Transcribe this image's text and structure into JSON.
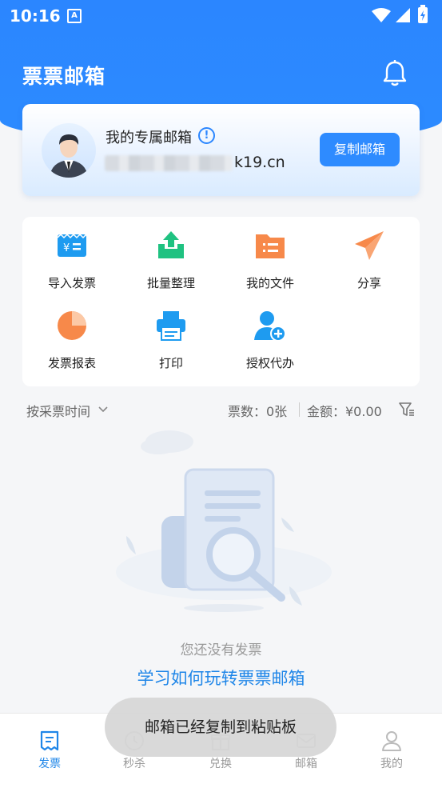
{
  "status_bar": {
    "time": "10:16",
    "notif_letter": "A"
  },
  "header": {
    "title": "票票邮箱"
  },
  "mailbox": {
    "label": "我的专属邮箱",
    "email_visible_suffix": "k19.cn",
    "copy_button": "复制邮箱"
  },
  "quick_actions": [
    {
      "label": "导入发票",
      "icon": "invoice-import-icon",
      "color": "#1e9bf0"
    },
    {
      "label": "批量整理",
      "icon": "upload-tray-icon",
      "color": "#1fc281"
    },
    {
      "label": "我的文件",
      "icon": "folder-icon",
      "color": "#f7894a"
    },
    {
      "label": "分享",
      "icon": "paper-plane-icon",
      "color": "#f7894a"
    },
    {
      "label": "发票报表",
      "icon": "pie-chart-icon",
      "color": "#f7894a"
    },
    {
      "label": "打印",
      "icon": "printer-icon",
      "color": "#1e9bf0"
    },
    {
      "label": "授权代办",
      "icon": "user-add-icon",
      "color": "#1e9bf0"
    }
  ],
  "filter": {
    "sort_label": "按采票时间",
    "count_text": "票数：0张",
    "amount_text": "金额：¥0.00"
  },
  "empty_state": {
    "message": "您还没有发票",
    "link": "学习如何玩转票票邮箱"
  },
  "bottom_nav": [
    {
      "label": "发票",
      "active": true
    },
    {
      "label": "秒杀",
      "active": false
    },
    {
      "label": "兑换",
      "active": false
    },
    {
      "label": "邮箱",
      "active": false
    },
    {
      "label": "我的",
      "active": false
    }
  ],
  "toast": {
    "text": "邮箱已经复制到粘贴板"
  },
  "colors": {
    "primary": "#2b86ff",
    "link": "#1f86e8"
  }
}
